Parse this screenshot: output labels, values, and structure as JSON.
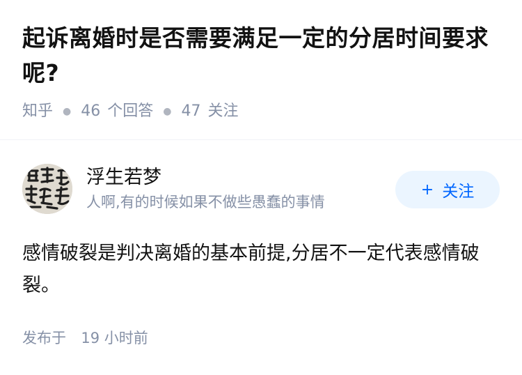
{
  "question": {
    "title": "起诉离婚时是否需要满足一定的分居时间要求呢?",
    "source": "知乎",
    "answer_count": "46",
    "answer_label": "个回答",
    "follower_count": "47",
    "follower_label": "关注"
  },
  "answer": {
    "author_name": "浮生若梦",
    "author_bio": "人啊,有的时候如果不做些愚蠢的事情",
    "follow_button_label": "关注",
    "follow_button_icon": "plus-icon",
    "avatar_icon": "calligraphy-avatar",
    "content": "感情破裂是判决离婚的基本前提,分居不一定代表感情破裂。",
    "time_prefix": "发布于",
    "time_value": "19 小时前"
  },
  "colors": {
    "primary_text": "#121212",
    "secondary_text": "#8590a6",
    "accent": "#0066ff",
    "follow_bg": "#ebf5ff",
    "divider": "#f0f2f7"
  }
}
